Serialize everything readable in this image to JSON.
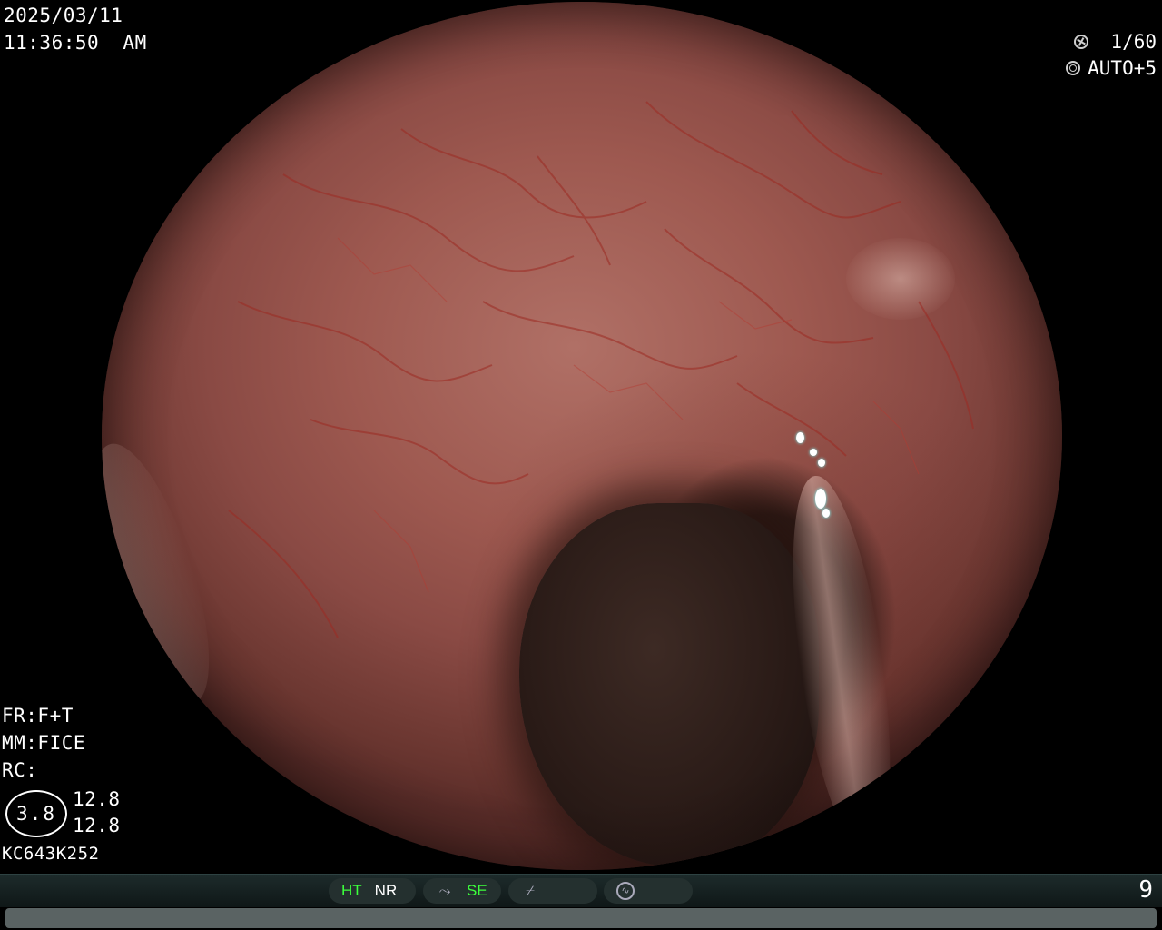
{
  "header": {
    "date": "2025/03/11",
    "time": "11:36:50  AM",
    "shutter_icon": "shutter-icon",
    "shutter_value": "1/60",
    "iris_icon": "iris-icon",
    "iris_value": "AUTO+5"
  },
  "settings": {
    "fr": "FR:F+T",
    "mm": "MM:FICE",
    "rc": "RC:",
    "octagon_value": "3.8",
    "value_1": "12.8",
    "value_2": "12.8",
    "scope_id": "KC643K252"
  },
  "status_bar": {
    "ht": "HT",
    "nr": "NR",
    "se": "SE",
    "page": "9",
    "colors": {
      "active": "#3cff3c",
      "inactive": "#ffffff",
      "bar": "#1d2b2b"
    },
    "icons": [
      "structure-enhance-icon",
      "contrast-icon",
      "auto-gain-icon"
    ]
  }
}
